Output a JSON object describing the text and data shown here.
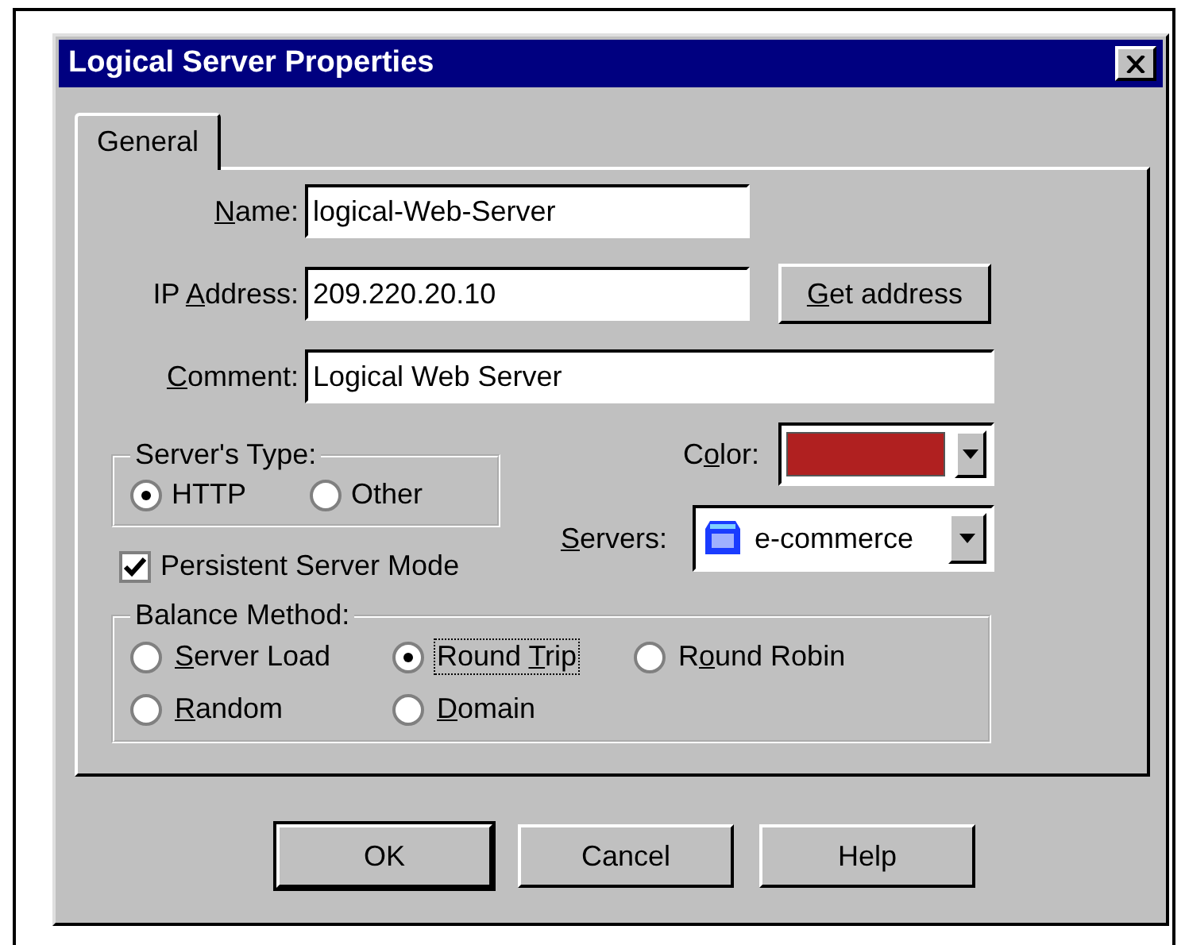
{
  "window": {
    "title": "Logical Server Properties"
  },
  "tabs": [
    {
      "label": "General",
      "selected": true
    }
  ],
  "name_field": {
    "label": {
      "key": "N",
      "after": "ame:"
    },
    "value": "logical-Web-Server"
  },
  "ip_field": {
    "label": {
      "before": "IP ",
      "key": "A",
      "after": "ddress:"
    },
    "value": "209.220.20.10"
  },
  "get_address_button": {
    "key": "G",
    "after": "et address"
  },
  "comment_field": {
    "label": {
      "key": "C",
      "after": "omment:"
    },
    "value": "Logical Web Server"
  },
  "server_type": {
    "title": "Server's Type:",
    "options": [
      {
        "label": "HTTP",
        "selected": true
      },
      {
        "label": "Other",
        "selected": false
      }
    ]
  },
  "color_picker": {
    "label": {
      "before": "C",
      "key": "o",
      "after": "lor:"
    },
    "color": "#b02020"
  },
  "servers": {
    "label": {
      "key": "S",
      "after": "ervers:"
    },
    "value": "e-commerce"
  },
  "persistent": {
    "label": "Persistent Server Mode",
    "checked": true
  },
  "balance": {
    "title": "Balance Method:",
    "options": [
      {
        "label": {
          "key": "S",
          "after": "erver Load"
        },
        "selected": false,
        "focused": false
      },
      {
        "label": {
          "before": "Round ",
          "key": "T",
          "after": "rip"
        },
        "selected": true,
        "focused": true
      },
      {
        "label": {
          "before": "R",
          "key": "o",
          "after": "und Robin"
        },
        "selected": false,
        "focused": false
      },
      {
        "label": {
          "key": "R",
          "after": "andom"
        },
        "selected": false,
        "focused": false
      },
      {
        "label": {
          "key": "D",
          "after": "omain"
        },
        "selected": false,
        "focused": false
      }
    ]
  },
  "buttons": [
    {
      "label": "OK",
      "default": true
    },
    {
      "label": "Cancel",
      "default": false
    },
    {
      "label": "Help",
      "default": false
    }
  ]
}
